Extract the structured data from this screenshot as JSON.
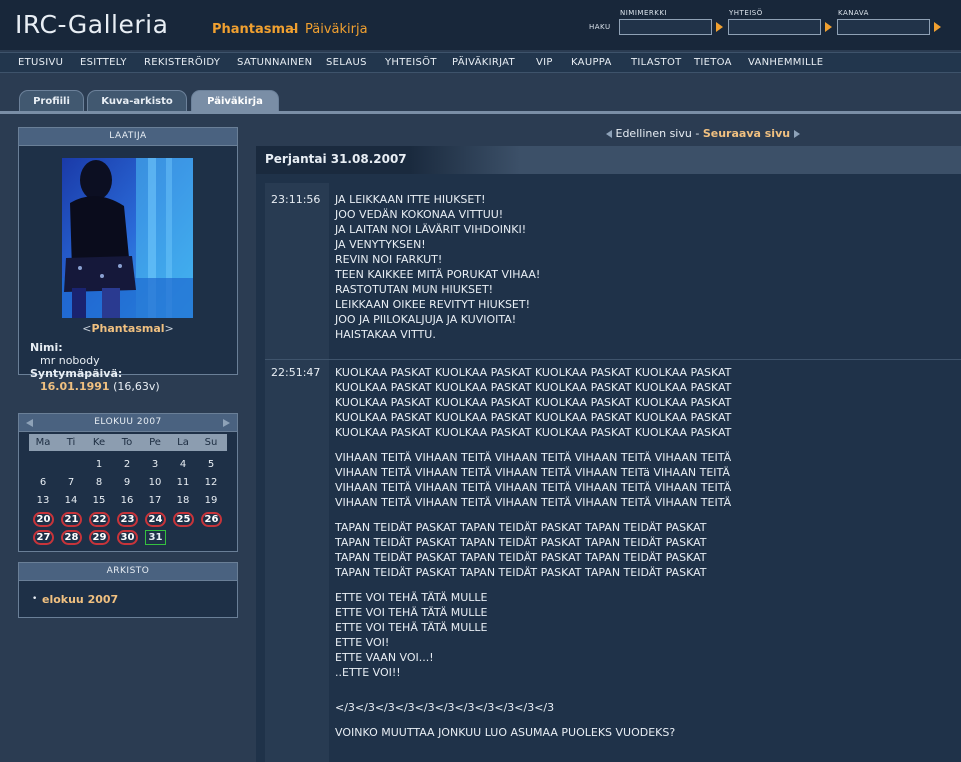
{
  "header": {
    "logo": "IRC-Galleria",
    "user": "Phantasmal",
    "separator": "-",
    "section": "Päiväkirja",
    "haku_label": "HAKU",
    "search": {
      "nick_label": "NIMIMERKKI",
      "community_label": "YHTEISÖ",
      "channel_label": "KANAVA"
    }
  },
  "nav": [
    "ETUSIVU",
    "ESITTELY",
    "REKISTERÖIDY",
    "SATUNNAINEN",
    "SELAUS",
    "YHTEISÖT",
    "PÄIVÄKIRJAT",
    "VIP",
    "KAUPPA",
    "TILASTOT",
    "TIETOA",
    "VANHEMMILLE"
  ],
  "tabs": [
    "Profiili",
    "Kuva-arkisto",
    "Päiväkirja"
  ],
  "active_tab": "Päiväkirja",
  "profile": {
    "title": "LAATIJA",
    "username": "Phantasmal",
    "link_left": "<",
    "link_right": ">",
    "name_label": "Nimi:",
    "name": "mr nobody",
    "birth_label": "Syntymäpäivä:",
    "birth_date": "16.01.1991",
    "age": "(16,63v)"
  },
  "calendar": {
    "title": "ELOKUU 2007",
    "weekdays": [
      "Ma",
      "Ti",
      "Ke",
      "To",
      "Pe",
      "La",
      "Su"
    ],
    "weeks": [
      [
        "",
        "",
        "1",
        "2",
        "3",
        "4",
        "5"
      ],
      [
        "6",
        "7",
        "8",
        "9",
        "10",
        "11",
        "12"
      ],
      [
        "13",
        "14",
        "15",
        "16",
        "17",
        "18",
        "19"
      ],
      [
        "20",
        "21",
        "22",
        "23",
        "24",
        "25",
        "26"
      ],
      [
        "27",
        "28",
        "29",
        "30",
        "31",
        "",
        ""
      ]
    ],
    "post_days": [
      "20",
      "21",
      "22",
      "23",
      "24",
      "25",
      "26",
      "27",
      "28",
      "29",
      "30"
    ],
    "today": "31"
  },
  "archive": {
    "title": "ARKISTO",
    "items": [
      "elokuu 2007"
    ]
  },
  "pager": {
    "prev": "Edellinen sivu",
    "sep": "-",
    "next": "Seuraava sivu"
  },
  "date_header": "Perjantai 31.08.2007",
  "entries": [
    {
      "time": "23:11:56",
      "lines": [
        "JA LEIKKAAN ITTE HIUKSET!",
        "JOO VEDÄN KOKONAA VITTUU!",
        "JA LAITAN NOI LÄVÄRIT VIHDOINKI!",
        "JA VENYTYKSEN!",
        "REVIN NOI FARKUT!",
        "TEEN KAIKKEE MITÄ PORUKAT VIHAA!",
        "RASTOTUTAN MUN HIUKSET!",
        "LEIKKAAN OIKEE REVITYT HIUKSET!",
        "JOO JA PIILOKALJUJA JA KUVIOITA!",
        "HAISTAKAA VITTU."
      ]
    },
    {
      "time": "22:51:47",
      "lines": [
        "KUOLKAA PASKAT KUOLKAA PASKAT KUOLKAA PASKAT KUOLKAA PASKAT",
        "KUOLKAA PASKAT KUOLKAA PASKAT KUOLKAA PASKAT KUOLKAA PASKAT",
        "KUOLKAA PASKAT KUOLKAA PASKAT KUOLKAA PASKAT KUOLKAA PASKAT",
        "KUOLKAA PASKAT KUOLKAA PASKAT KUOLKAA PASKAT KUOLKAA PASKAT",
        "KUOLKAA PASKAT KUOLKAA PASKAT KUOLKAA PASKAT KUOLKAA PASKAT",
        "",
        "VIHAAN TEITÄ VIHAAN TEITÄ VIHAAN TEITÄ VIHAAN TEITÄ VIHAAN TEITÄ",
        "VIHAAN TEITÄ VIHAAN TEITÄ VIHAAN TEITÄ VIHAAN TEITä VIHAAN TEITÄ",
        "VIHAAN TEITÄ VIHAAN TEITÄ VIHAAN TEITÄ VIHAAN TEITÄ VIHAAN TEITÄ",
        "VIHAAN TEITÄ VIHAAN TEITÄ VIHAAN TEITÄ VIHAAN TEITÄ VIHAAN TEITÄ",
        "",
        "TAPAN TEIDÄT PASKAT TAPAN TEIDÄT PASKAT TAPAN TEIDÄT PASKAT",
        "TAPAN TEIDÄT PASKAT TAPAN TEIDÄT PASKAT TAPAN TEIDÄT PASKAT",
        "TAPAN TEIDÄT PASKAT TAPAN TEIDÄT PASKAT TAPAN TEIDÄT PASKAT",
        "TAPAN TEIDÄT PASKAT TAPAN TEIDÄT PASKAT TAPAN TEIDÄT PASKAT",
        "",
        "ETTE VOI TEHÄ TÄTÄ MULLE",
        "ETTE VOI TEHÄ TÄTÄ MULLE",
        "ETTE VOI TEHÄ TÄTÄ MULLE",
        "ETTE VOI!",
        "ETTE VAAN VOI...!",
        "..ETTE VOI!!",
        "",
        "",
        "</3</3</3</3</3</3</3</3</3</3</3",
        "",
        "VOINKO MUUTTAA JONKUU LUO ASUMAA PUOLEKS VUODEKS?"
      ]
    }
  ],
  "colors": {
    "background": "#2b3c52",
    "header": "#18273a",
    "accent": "#f0a030",
    "link": "#f0c080",
    "post_circle": "#c8343a",
    "today_box": "#35c040"
  }
}
